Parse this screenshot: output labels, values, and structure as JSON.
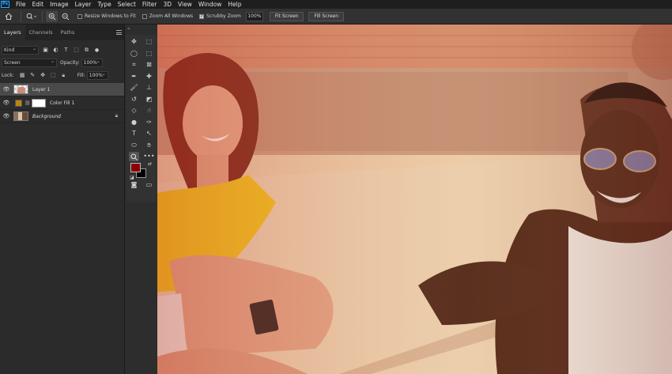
{
  "app": {
    "logo": "Ps"
  },
  "menubar": {
    "items": [
      "File",
      "Edit",
      "Image",
      "Layer",
      "Type",
      "Select",
      "Filter",
      "3D",
      "View",
      "Window",
      "Help"
    ]
  },
  "options": {
    "resize_windows": {
      "label": "Resize Windows to Fit",
      "checked": false
    },
    "zoom_all": {
      "label": "Zoom All Windows",
      "checked": false
    },
    "scrubby_zoom": {
      "label": "Scrubby Zoom",
      "checked": true
    },
    "zoom_value": "100%",
    "fit_screen": "Fit Screen",
    "fill_screen": "Fill Screen"
  },
  "panel": {
    "tabs": [
      "Layers",
      "Channels",
      "Paths"
    ],
    "filter_kind": "Kind",
    "blend_mode": "Screen",
    "opacity_label": "Opacity:",
    "opacity_value": "100%",
    "lock_label": "Lock:",
    "fill_label": "Fill:",
    "fill_value": "100%",
    "layers": [
      {
        "name": "Layer 1",
        "selected": true
      },
      {
        "name": "Color Fill 1",
        "fill_color": "#b8860b"
      },
      {
        "name": "Background",
        "locked": true
      }
    ]
  },
  "colors": {
    "foreground": "#8b0000",
    "background": "#000000"
  }
}
